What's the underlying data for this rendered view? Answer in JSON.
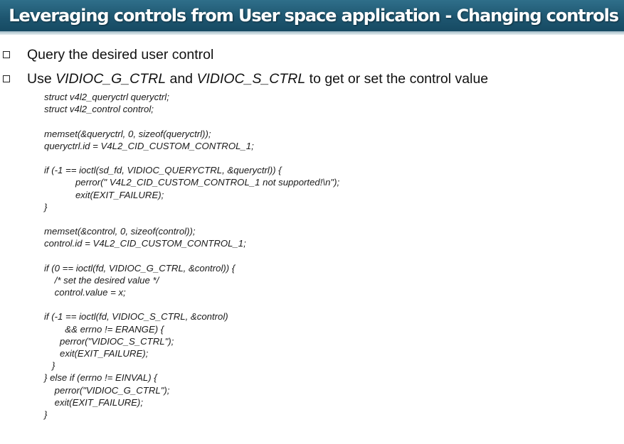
{
  "slide": {
    "title": "Leveraging controls from User space application - Changing controls",
    "bullets": [
      {
        "text": "Query the desired user control"
      },
      {
        "parts": [
          "Use ",
          "VIDIOC_G_CTRL",
          " and ",
          "VIDIOC_S_CTRL",
          " to get or set the control value"
        ]
      }
    ],
    "code_lines": [
      "struct v4l2_queryctrl queryctrl;",
      "struct v4l2_control control;",
      "",
      "memset(&queryctrl, 0, sizeof(queryctrl));",
      "queryctrl.id = V4L2_CID_CUSTOM_CONTROL_1;",
      "",
      "if (-1 == ioctl(sd_fd, VIDIOC_QUERYCTRL, &queryctrl)) {",
      "            perror(\" V4L2_CID_CUSTOM_CONTROL_1 not supported!\\n\");",
      "            exit(EXIT_FAILURE);",
      "}",
      "",
      "memset(&control, 0, sizeof(control));",
      "control.id = V4L2_CID_CUSTOM_CONTROL_1;",
      "",
      "if (0 == ioctl(fd, VIDIOC_G_CTRL, &control)) {",
      "    /* set the desired value */",
      "    control.value = x;",
      "",
      "if (-1 == ioctl(fd, VIDIOC_S_CTRL, &control)",
      "        && errno != ERANGE) {",
      "      perror(\"VIDIOC_S_CTRL\");",
      "      exit(EXIT_FAILURE);",
      "   }",
      "} else if (errno != EINVAL) {",
      "    perror(\"VIDIOC_G_CTRL\");",
      "    exit(EXIT_FAILURE);",
      "}"
    ]
  }
}
